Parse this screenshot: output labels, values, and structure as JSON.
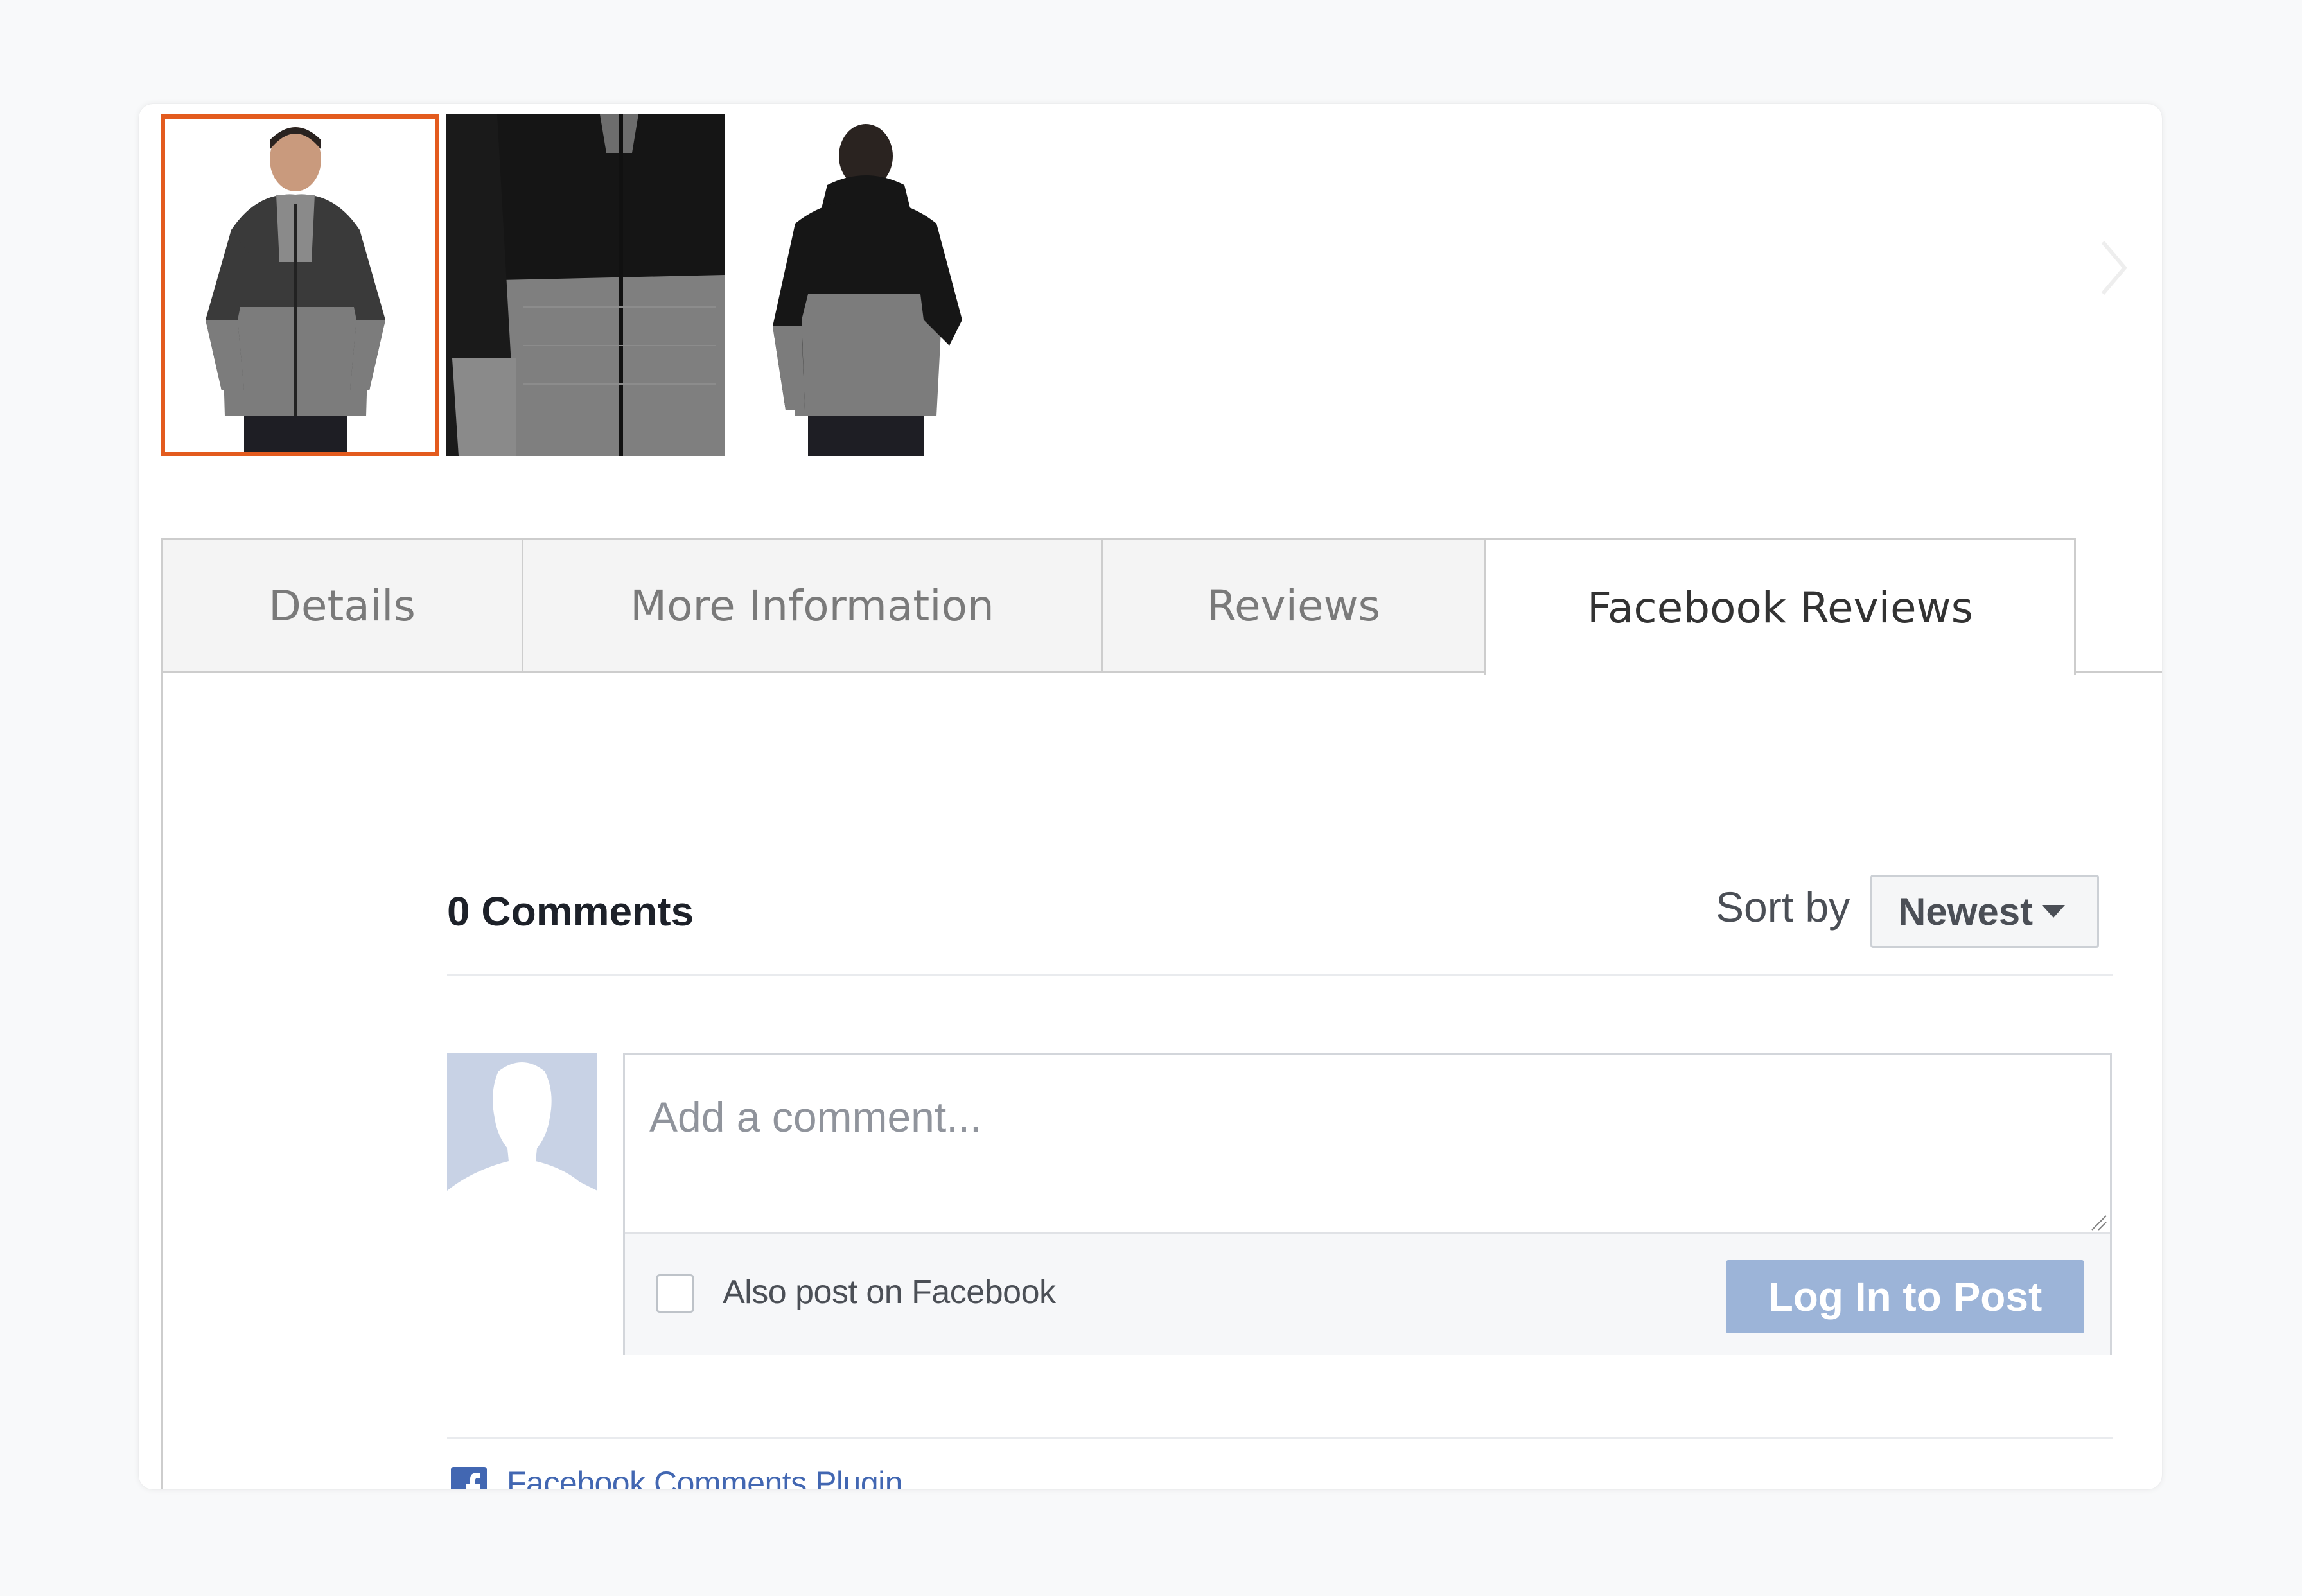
{
  "gallery": {
    "thumbnails": [
      {
        "icon": "photo-front-view",
        "active": true
      },
      {
        "icon": "photo-detail-view",
        "active": false
      },
      {
        "icon": "photo-back-view",
        "active": false
      }
    ],
    "active_border_color": "#e35b1e",
    "next_icon": "chevron-right-icon"
  },
  "tabs": [
    {
      "label": "Details",
      "active": false
    },
    {
      "label": "More Information",
      "active": false
    },
    {
      "label": "Reviews",
      "active": false
    },
    {
      "label": "Facebook Reviews",
      "active": true
    }
  ],
  "comments": {
    "count_label": "0 Comments",
    "sort_label": "Sort by",
    "sort_value": "Newest",
    "comment_placeholder": "Add a comment...",
    "also_post_label": "Also post on Facebook",
    "also_post_checked": false,
    "login_button": "Log In to Post",
    "plugin_label": "Facebook Comments Plugin",
    "avatar_icon": "default-avatar-icon",
    "login_button_color": "#9cb4d8",
    "link_color": "#4267b2"
  }
}
